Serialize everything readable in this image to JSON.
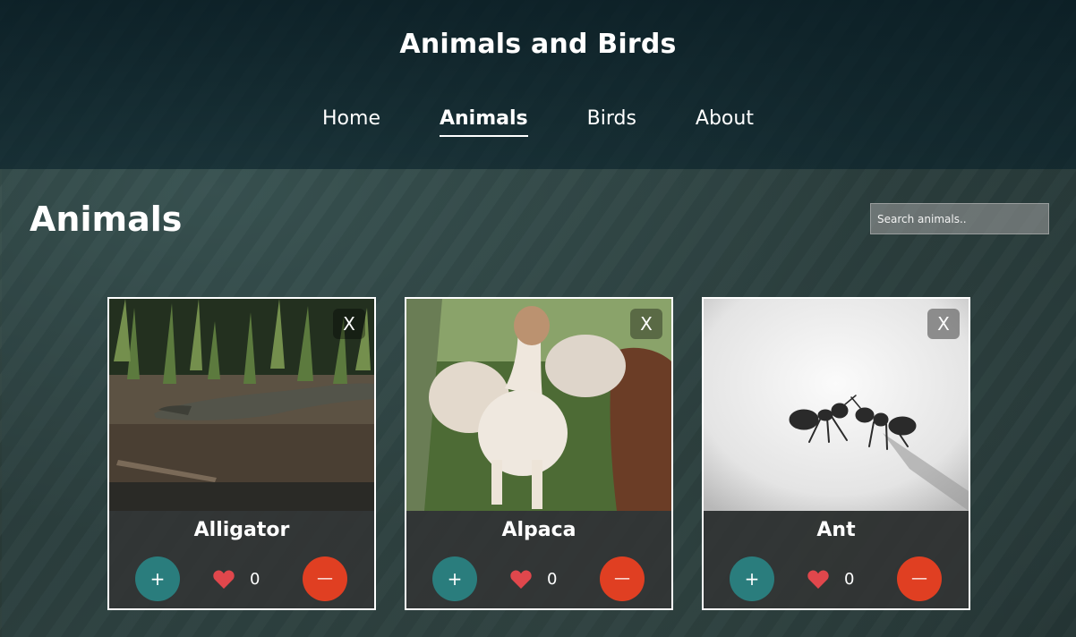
{
  "header": {
    "title": "Animals and Birds",
    "nav": [
      {
        "label": "Home",
        "active": false
      },
      {
        "label": "Animals",
        "active": true
      },
      {
        "label": "Birds",
        "active": false
      },
      {
        "label": "About",
        "active": false
      }
    ]
  },
  "main": {
    "heading": "Animals",
    "search": {
      "placeholder": "Search animals..",
      "value": ""
    },
    "cards": [
      {
        "name": "Alligator",
        "likes": "0",
        "close_label": "X",
        "plus_label": "+",
        "minus_label": "—",
        "image": "alligator on riverbank"
      },
      {
        "name": "Alpaca",
        "likes": "0",
        "close_label": "X",
        "plus_label": "+",
        "minus_label": "—",
        "image": "alpacas on grass"
      },
      {
        "name": "Ant",
        "likes": "0",
        "close_label": "X",
        "plus_label": "+",
        "minus_label": "—",
        "image": "ant on white surface"
      }
    ]
  },
  "colors": {
    "plus": "#2a7d7d",
    "minus": "#e03f22",
    "heart": "#e0474c"
  },
  "icons": {
    "like": "heart-icon",
    "remove": "close-icon"
  }
}
